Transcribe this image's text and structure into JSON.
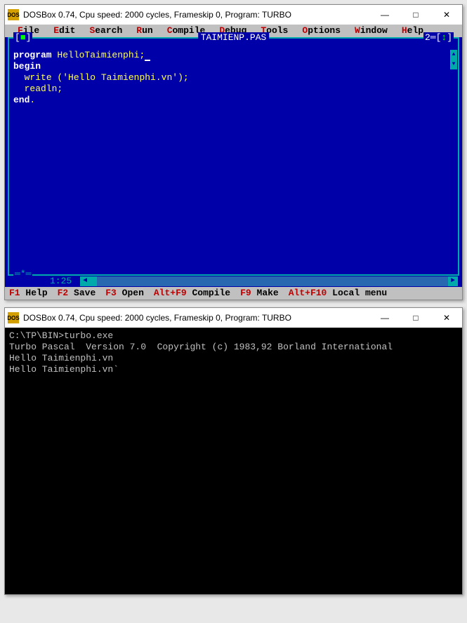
{
  "window1": {
    "titlebar": "DOSBox 0.74, Cpu speed:    2000 cycles, Frameskip  0, Program:    TURBO",
    "minimize": "—",
    "maximize": "□",
    "close": "✕"
  },
  "menu": [
    {
      "hotkey": "F",
      "rest": "ile"
    },
    {
      "hotkey": "E",
      "rest": "dit"
    },
    {
      "hotkey": "S",
      "rest": "earch"
    },
    {
      "hotkey": "R",
      "rest": "un"
    },
    {
      "hotkey": "C",
      "rest": "ompile"
    },
    {
      "hotkey": "D",
      "rest": "ebug"
    },
    {
      "hotkey": "T",
      "rest": "ools"
    },
    {
      "hotkey": "O",
      "rest": "ptions"
    },
    {
      "hotkey": "W",
      "rest": "indow"
    },
    {
      "hotkey": "H",
      "rest": "elp"
    }
  ],
  "editor": {
    "filename": "TAIMIENP.PAS",
    "close_marker_l": "[",
    "close_marker_c": "■",
    "close_marker_r": "]",
    "winnum_prefix": "2═[",
    "winnum_arrow": "↕",
    "winnum_suffix": "]",
    "modified": "*",
    "coords": "1:25",
    "hscroll_l": "◄",
    "hscroll_r": "►",
    "vscroll_u": "▲",
    "vscroll_d": "▼",
    "code": {
      "l1_kw": "program ",
      "l1_id": "HelloTaimienphi;",
      "l2_kw": "begin",
      "l3_ind": "  ",
      "l3_fn": "write ",
      "l3_p1": "(",
      "l3_str": "'Hello Taimienphi.vn'",
      "l3_p2": ");",
      "l4_ind": "  ",
      "l4_fn": "readln;",
      "l5_kw": "end",
      "l5_dot": "."
    }
  },
  "statusbar": [
    {
      "fkey": "F1",
      "desc": " Help"
    },
    {
      "fkey": "F2",
      "desc": " Save"
    },
    {
      "fkey": "F3",
      "desc": " Open"
    },
    {
      "fkey": "Alt+F9",
      "desc": " Compile"
    },
    {
      "fkey": "F9",
      "desc": " Make"
    },
    {
      "fkey": "Alt+F10",
      "desc": " Local menu"
    }
  ],
  "window2": {
    "titlebar": "DOSBox 0.74, Cpu speed:    2000 cycles, Frameskip  0, Program:    TURBO",
    "minimize": "—",
    "maximize": "□",
    "close": "✕"
  },
  "console": {
    "l1": "C:\\TP\\BIN>turbo.exe",
    "l2": "Turbo Pascal  Version 7.0  Copyright (c) 1983,92 Borland International",
    "l3": "Hello Taimienphi.vn",
    "l4": "Hello Taimienphi.vn`"
  }
}
